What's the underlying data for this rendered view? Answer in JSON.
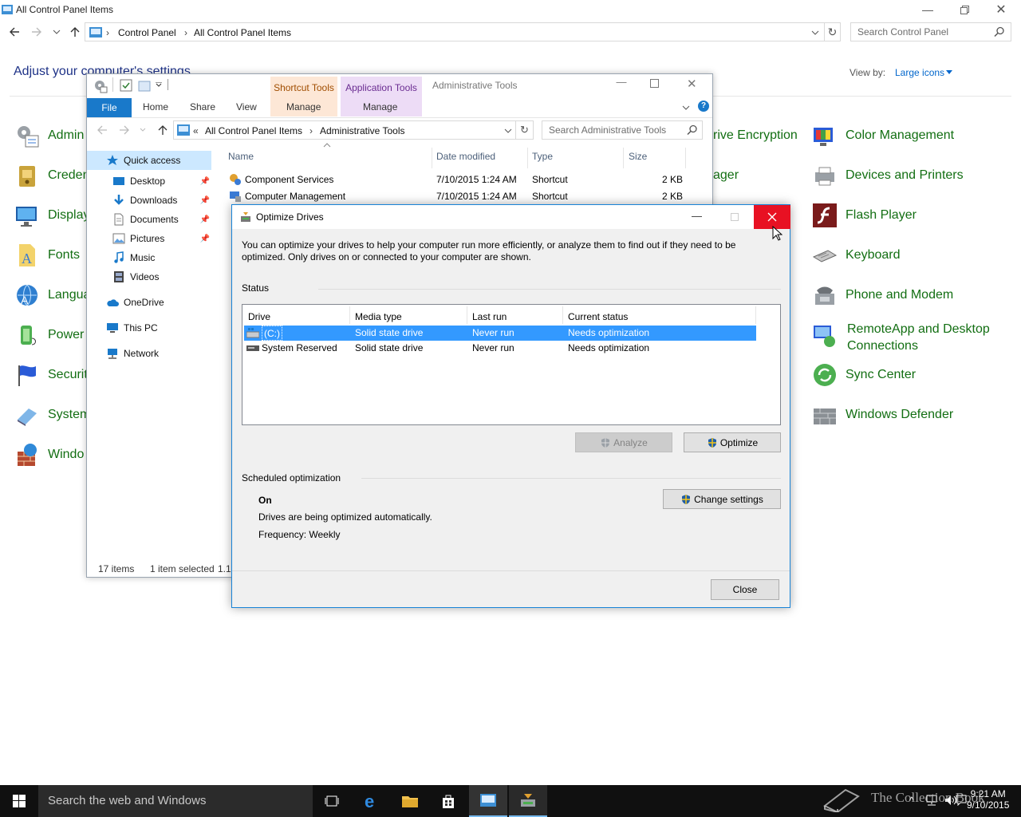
{
  "control_panel": {
    "title": "All Control Panel Items",
    "breadcrumb": [
      "Control Panel",
      "All Control Panel Items"
    ],
    "search_placeholder": "Search Control Panel",
    "heading": "Adjust your computer's settings",
    "view_by_label": "View by:",
    "view_by_value": "Large icons",
    "left_items": [
      "Admin",
      "Creden",
      "Display",
      "Fonts",
      "Langua",
      "Power",
      "Securit",
      "System",
      "Windo"
    ],
    "middle_items": [
      "rive Encryption",
      "ager"
    ],
    "right_items": [
      "Color Management",
      "Devices and Printers",
      "Flash Player",
      "Keyboard",
      "Phone and Modem",
      "RemoteApp and Desktop Connections",
      "Sync Center",
      "Windows Defender"
    ]
  },
  "explorer": {
    "ribbon_contexts": {
      "shortcut_tools": "Shortcut Tools",
      "application_tools": "Application Tools"
    },
    "title": "Administrative Tools",
    "tabs": {
      "file": "File",
      "home": "Home",
      "share": "Share",
      "view": "View",
      "manage1": "Manage",
      "manage2": "Manage"
    },
    "address": {
      "prefix": "«",
      "crumb1": "All Control Panel Items",
      "crumb2": "Administrative Tools"
    },
    "search_placeholder": "Search Administrative Tools",
    "sidebar": {
      "quick_access": "Quick access",
      "desktop": "Desktop",
      "downloads": "Downloads",
      "documents": "Documents",
      "pictures": "Pictures",
      "music": "Music",
      "videos": "Videos",
      "onedrive": "OneDrive",
      "this_pc": "This PC",
      "network": "Network"
    },
    "columns": {
      "name": "Name",
      "date": "Date modified",
      "type": "Type",
      "size": "Size"
    },
    "files": [
      {
        "name": "Component Services",
        "date": "7/10/2015 1:24 AM",
        "type": "Shortcut",
        "size": "2 KB"
      },
      {
        "name": "Computer Management",
        "date": "7/10/2015 1:24 AM",
        "type": "Shortcut",
        "size": "2 KB"
      }
    ],
    "status": {
      "items": "17 items",
      "selected": "1 item selected",
      "size": "1.1"
    }
  },
  "optimize": {
    "title": "Optimize Drives",
    "intro": "You can optimize your drives to help your computer run more efficiently, or analyze them to find out if they need to be optimized. Only drives on or connected to your computer are shown.",
    "status_label": "Status",
    "columns": {
      "drive": "Drive",
      "media": "Media type",
      "last_run": "Last run",
      "status": "Current status"
    },
    "drives": [
      {
        "drive": "(C:)",
        "media": "Solid state drive",
        "last_run": "Never run",
        "status": "Needs optimization",
        "selected": true
      },
      {
        "drive": "System Reserved",
        "media": "Solid state drive",
        "last_run": "Never run",
        "status": "Needs optimization",
        "selected": false
      }
    ],
    "analyze_label": "Analyze",
    "optimize_label": "Optimize",
    "scheduled_label": "Scheduled optimization",
    "schedule_state": "On",
    "schedule_desc": "Drives are being optimized automatically.",
    "frequency": "Frequency: Weekly",
    "change_settings_label": "Change settings",
    "close_label": "Close"
  },
  "taskbar": {
    "search_placeholder": "Search the web and Windows",
    "time": "9:21 AM",
    "date": "9/10/2015"
  },
  "watermark": "The Collection Book",
  "colors": {
    "accent": "#0078d7",
    "selection": "#3399ff",
    "close_red": "#e81123",
    "link_green": "#126e12",
    "file_tab": "#1979ca"
  }
}
